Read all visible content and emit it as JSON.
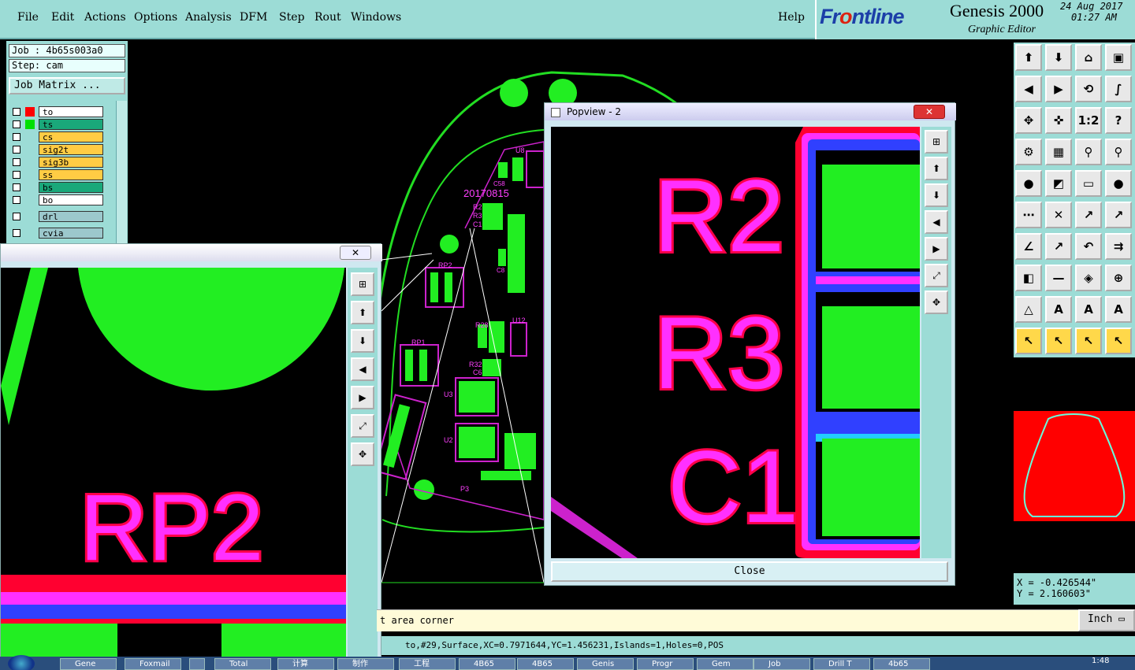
{
  "menu": [
    "File",
    "Edit",
    "Actions",
    "Options",
    "Analysis",
    "DFM",
    "Step",
    "Rout",
    "Windows"
  ],
  "help_label": "Help",
  "brand": {
    "logo_pre": "Fr",
    "logo_x": "o",
    "logo_post": "ntline",
    "product": "Genesis 2000",
    "subtitle": "Graphic Editor",
    "date": "24 Aug 2017",
    "time": "01:27 AM"
  },
  "job": {
    "job_label": "Job : 4b65s003a0",
    "step_label": "Step: cam",
    "matrix_button": "Job Matrix ..."
  },
  "layers": [
    {
      "name": "to",
      "color": "#ff0000",
      "bg": "#ffffff"
    },
    {
      "name": "ts",
      "color": "#00e000",
      "bg": "#1aa87a"
    },
    {
      "name": "cs",
      "color": "",
      "bg": "#ffcc44"
    },
    {
      "name": "sig2t",
      "color": "",
      "bg": "#ffcc44"
    },
    {
      "name": "sig3b",
      "color": "",
      "bg": "#ffcc44"
    },
    {
      "name": "ss",
      "color": "",
      "bg": "#ffcc44"
    },
    {
      "name": "bs",
      "color": "",
      "bg": "#1aa87a"
    },
    {
      "name": "bo",
      "color": "",
      "bg": "#ffffff"
    },
    {
      "name": "drl",
      "color": "",
      "bg": "#9cc8cc"
    },
    {
      "name": "cvia",
      "color": "",
      "bg": "#9cc8cc"
    }
  ],
  "toolbox": [
    "⬆",
    "⬇",
    "⌂",
    "▣",
    "◀",
    "▶",
    "⟲",
    "∫",
    "✥",
    "✜",
    "1:2",
    "?",
    "⚙",
    "▦",
    "⚲",
    "⚲",
    "●",
    "◩",
    "▭",
    "●",
    "⋯",
    "✕",
    "↗",
    "↗",
    "∠",
    "↗",
    "↶",
    "⇉",
    "◧",
    "—",
    "◈",
    "⊕",
    "△",
    "A",
    "A",
    "A",
    "↖",
    "↖",
    "↖",
    "↖"
  ],
  "coords": {
    "x": "X = -0.426544\"",
    "y": "Y = 2.160603\""
  },
  "prompt": "t area corner",
  "unit": "Inch",
  "status": "to,#29,Surface,XC=0.7971644,YC=1.456231,Islands=1,Holes=0,POS",
  "popview2": {
    "title": "Popview - 2",
    "close_label": "Close",
    "labels": [
      "R2",
      "R3",
      "C1"
    ]
  },
  "popview1": {
    "label": "RP2"
  },
  "board_labels": [
    "20170815",
    "RP2",
    "RP1",
    "R2",
    "R3",
    "C1",
    "U8",
    "C58",
    "C8",
    "R28",
    "U12",
    "R32",
    "C6",
    "U3",
    "U2",
    "P3"
  ],
  "taskbar": [
    "Gene",
    "Foxmail",
    "",
    "Total",
    "计算",
    "制作",
    "工程",
    "4B65",
    "4B65",
    "Genis",
    "Progr",
    "Gem",
    "Job",
    "Drill T",
    "4b65"
  ],
  "clock": "1:48"
}
